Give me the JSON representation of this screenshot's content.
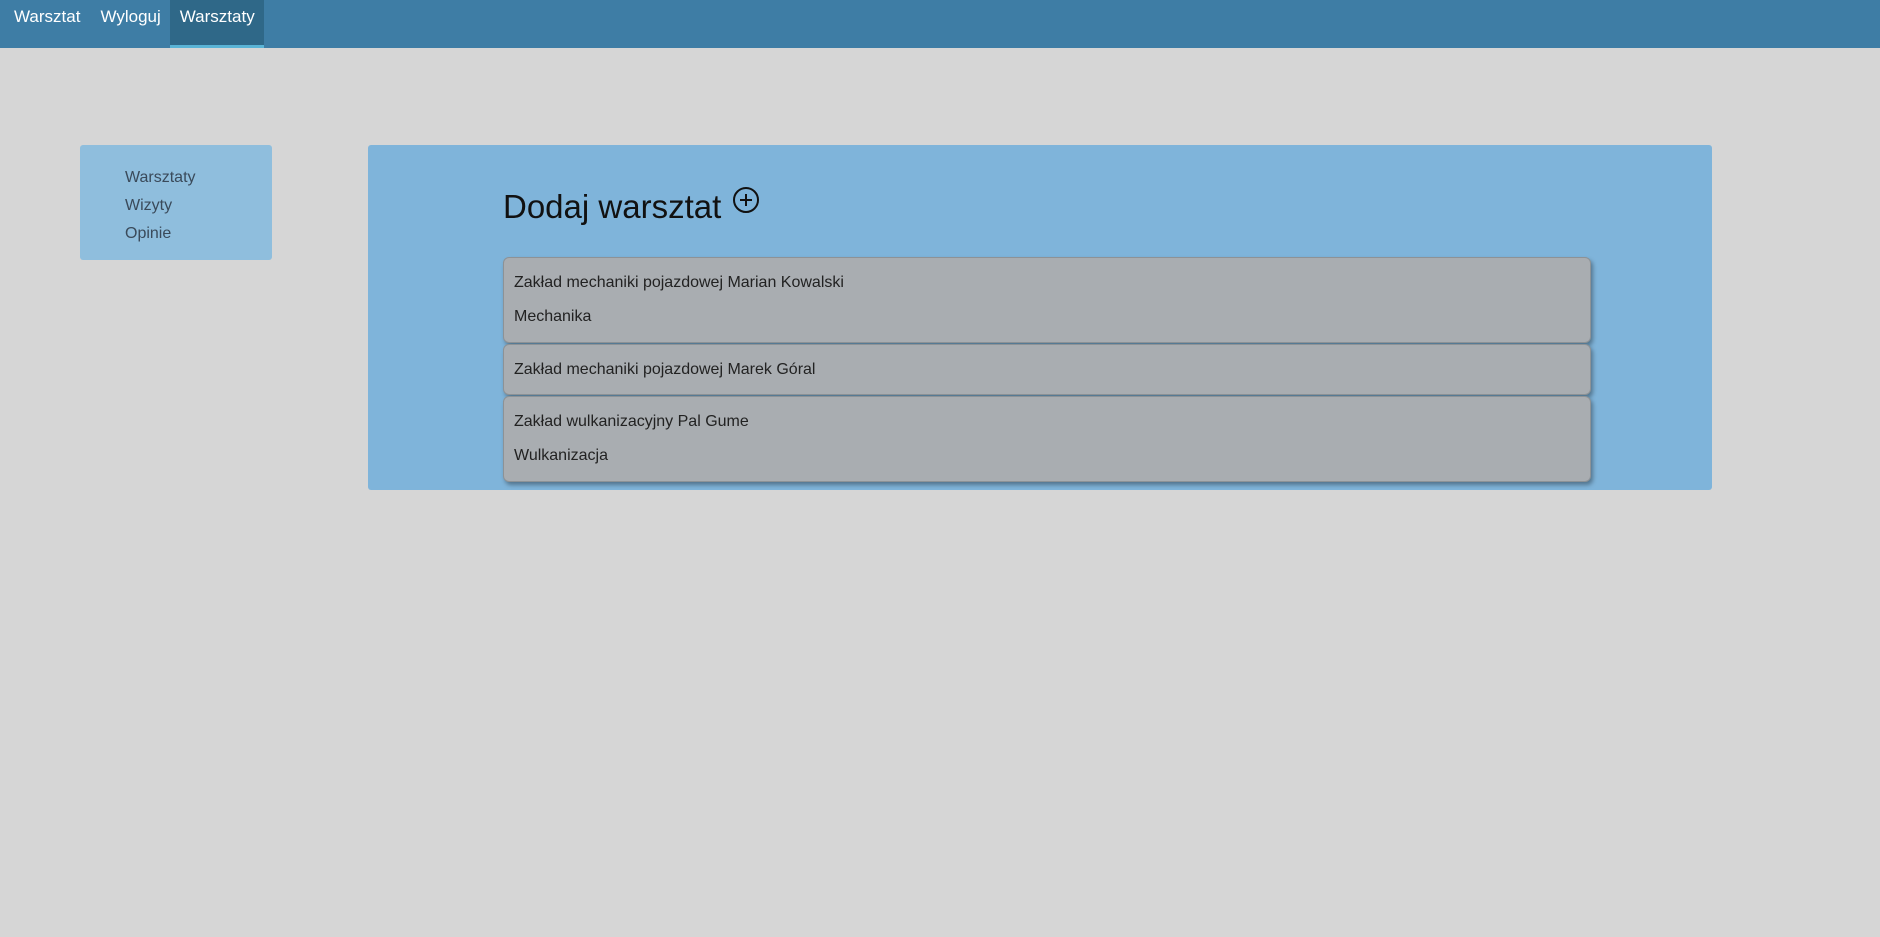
{
  "topbar": {
    "links": [
      {
        "label": "Warsztat"
      },
      {
        "label": "Wyloguj"
      },
      {
        "label": "Warsztaty"
      }
    ]
  },
  "sidebar": {
    "items": [
      {
        "label": "Warsztaty"
      },
      {
        "label": "Wizyty"
      },
      {
        "label": "Opinie"
      }
    ]
  },
  "main": {
    "add_title": "Dodaj warsztat",
    "add_icon": "plus-circle-icon",
    "workshops": [
      {
        "name": "Zakład mechaniki pojazdowej Marian Kowalski",
        "category": "Mechanika"
      },
      {
        "name": "Zakład mechaniki pojazdowej Marek Góral",
        "category": ""
      },
      {
        "name": "Zakład wulkanizacyjny Pal Gume",
        "category": "Wulkanizacja"
      }
    ]
  },
  "colors": {
    "topbar": "#3e7da5",
    "topbar_active": "#2f6888",
    "page_bg": "#d6d6d6",
    "sidebar_bg": "#8fbedd",
    "panel_bg": "#7fb4da",
    "card_bg": "#a9adb1"
  }
}
